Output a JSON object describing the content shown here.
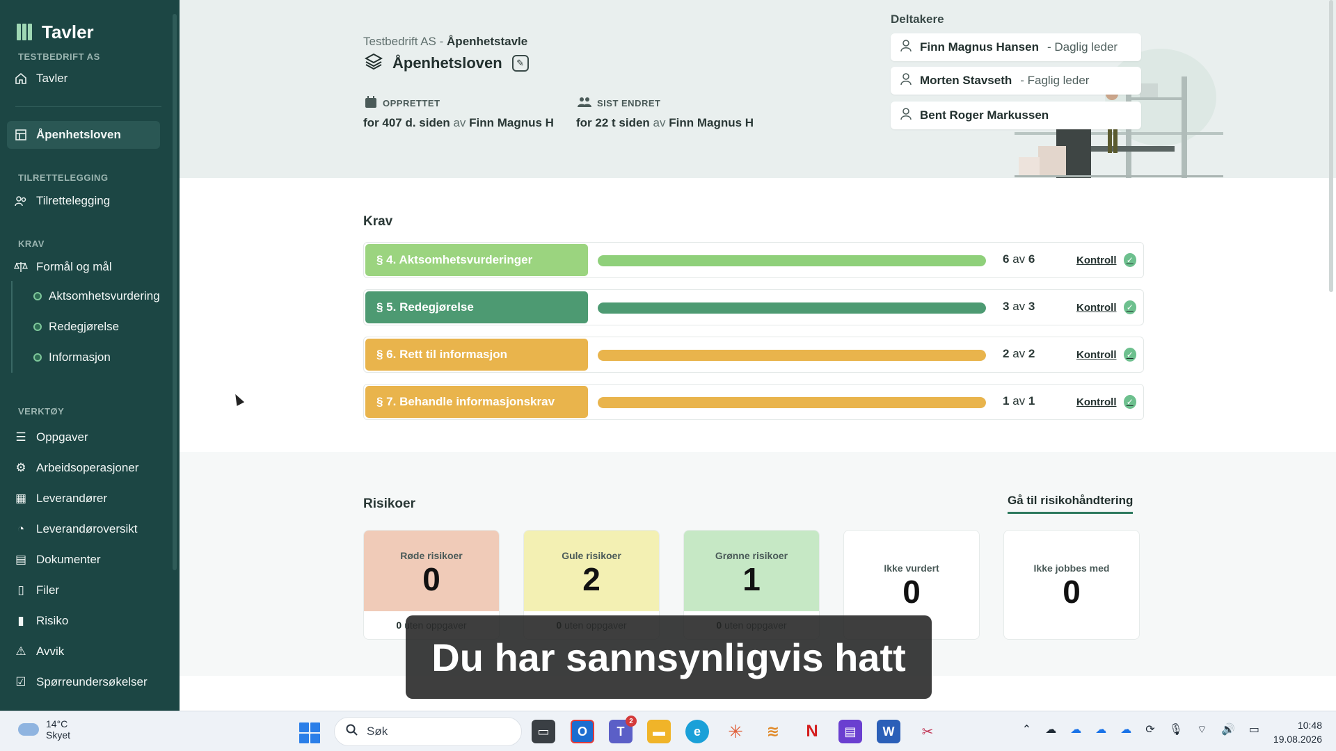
{
  "sidebar": {
    "brand": "Tavler",
    "company_label": "TESTBEDRIFT AS",
    "tavler": "Tavler",
    "active_board": "Åpenhetsloven",
    "section_tilrettelegging": "TILRETTELEGGING",
    "tilrettelegging": "Tilrettelegging",
    "section_krav": "KRAV",
    "formal": "Formål og mål",
    "sub": [
      "Aktsomhetsvurdering",
      "Redegjørelse",
      "Informasjon"
    ],
    "section_verktoy": "VERKTØY",
    "tools": [
      "Oppgaver",
      "Arbeidsoperasjoner",
      "Leverandører",
      "Leverandøroversikt",
      "Dokumenter",
      "Filer",
      "Risiko",
      "Avvik",
      "Spørreundersøkelser"
    ]
  },
  "header": {
    "company": "Testbedrift AS",
    "dash": "-",
    "board_type": "Åpenhetstavle",
    "title": "Åpenhetsloven",
    "created_label": "OPPRETTET",
    "created_prefix": "for 407 d. siden",
    "created_av": "av",
    "created_by": "Finn Magnus H",
    "changed_label": "SIST ENDRET",
    "changed_prefix": "for 22 t siden",
    "changed_av": "av",
    "changed_by": "Finn Magnus H",
    "participants_label": "Deltakere",
    "participants": [
      {
        "name": "Finn Magnus Hansen",
        "role": "- Daglig leder"
      },
      {
        "name": "Morten Stavseth",
        "role": "- Faglig leder"
      },
      {
        "name": "Bent Roger Markussen",
        "role": ""
      }
    ]
  },
  "krav": {
    "title": "Krav",
    "rows": [
      {
        "label": "§ 4. Aktsomhetsvurderinger",
        "done": "6",
        "av": "av",
        "total": "6",
        "progress": 1.0,
        "color": "#9bd47f",
        "bar": "#8fd07a",
        "kontroll": "Kontroll"
      },
      {
        "label": "§ 5. Redegjørelse",
        "done": "3",
        "av": "av",
        "total": "3",
        "progress": 1.0,
        "color": "#4d9a72",
        "bar": "#4d9a72",
        "kontroll": "Kontroll"
      },
      {
        "label": "§ 6. Rett til informasjon",
        "done": "2",
        "av": "av",
        "total": "2",
        "progress": 1.0,
        "color": "#e9b44c",
        "bar": "#e9b44c",
        "kontroll": "Kontroll"
      },
      {
        "label": "§ 7. Behandle informasjonskrav",
        "done": "1",
        "av": "av",
        "total": "1",
        "progress": 1.0,
        "color": "#e9b44c",
        "bar": "#e9b44c",
        "kontroll": "Kontroll"
      }
    ]
  },
  "risiko": {
    "title": "Risikoer",
    "link": "Gå til risikohåndtering",
    "cards": [
      {
        "name": "Røde risikoer",
        "value": "0",
        "foot_num": "0",
        "foot_text": "uten oppgaver",
        "color": "#f0cbb8"
      },
      {
        "name": "Gule risikoer",
        "value": "2",
        "foot_num": "0",
        "foot_text": "uten oppgaver",
        "color": "#f3f0b3"
      },
      {
        "name": "Grønne risikoer",
        "value": "1",
        "foot_num": "0",
        "foot_text": "uten oppgaver",
        "color": "#c6e8c5"
      },
      {
        "name": "Ikke vurdert",
        "value": "0"
      },
      {
        "name": "Ikke jobbes med",
        "value": "0"
      }
    ]
  },
  "subtitle": "Du har sannsynligvis hatt",
  "taskbar": {
    "temp": "14°C",
    "weather": "Skyet",
    "search_placeholder": "Søk",
    "badge": "2",
    "time": "10:48",
    "date": "19.08.2026"
  }
}
